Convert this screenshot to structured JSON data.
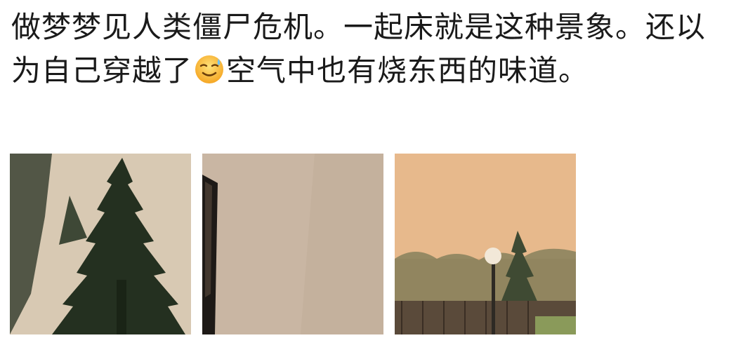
{
  "post": {
    "text_part1": "做梦梦见人类僵尸危机。一起床就是这种景象。还以为自己穿越了",
    "emoji_icon": "sweat-smile-face-icon",
    "text_part2": "空气中也有烧东西的味道。"
  },
  "photos": [
    {
      "icon": "smoky-sky-pine-tree-photo"
    },
    {
      "icon": "smoky-sky-wall-corner-photo"
    },
    {
      "icon": "smoky-sky-lamp-fence-photo"
    }
  ],
  "colors": {
    "text": "#1a1a1a",
    "sky_1": "#d8c9b3",
    "sky_2": "#c9b6a3",
    "sky_3": "#e7b98c"
  }
}
